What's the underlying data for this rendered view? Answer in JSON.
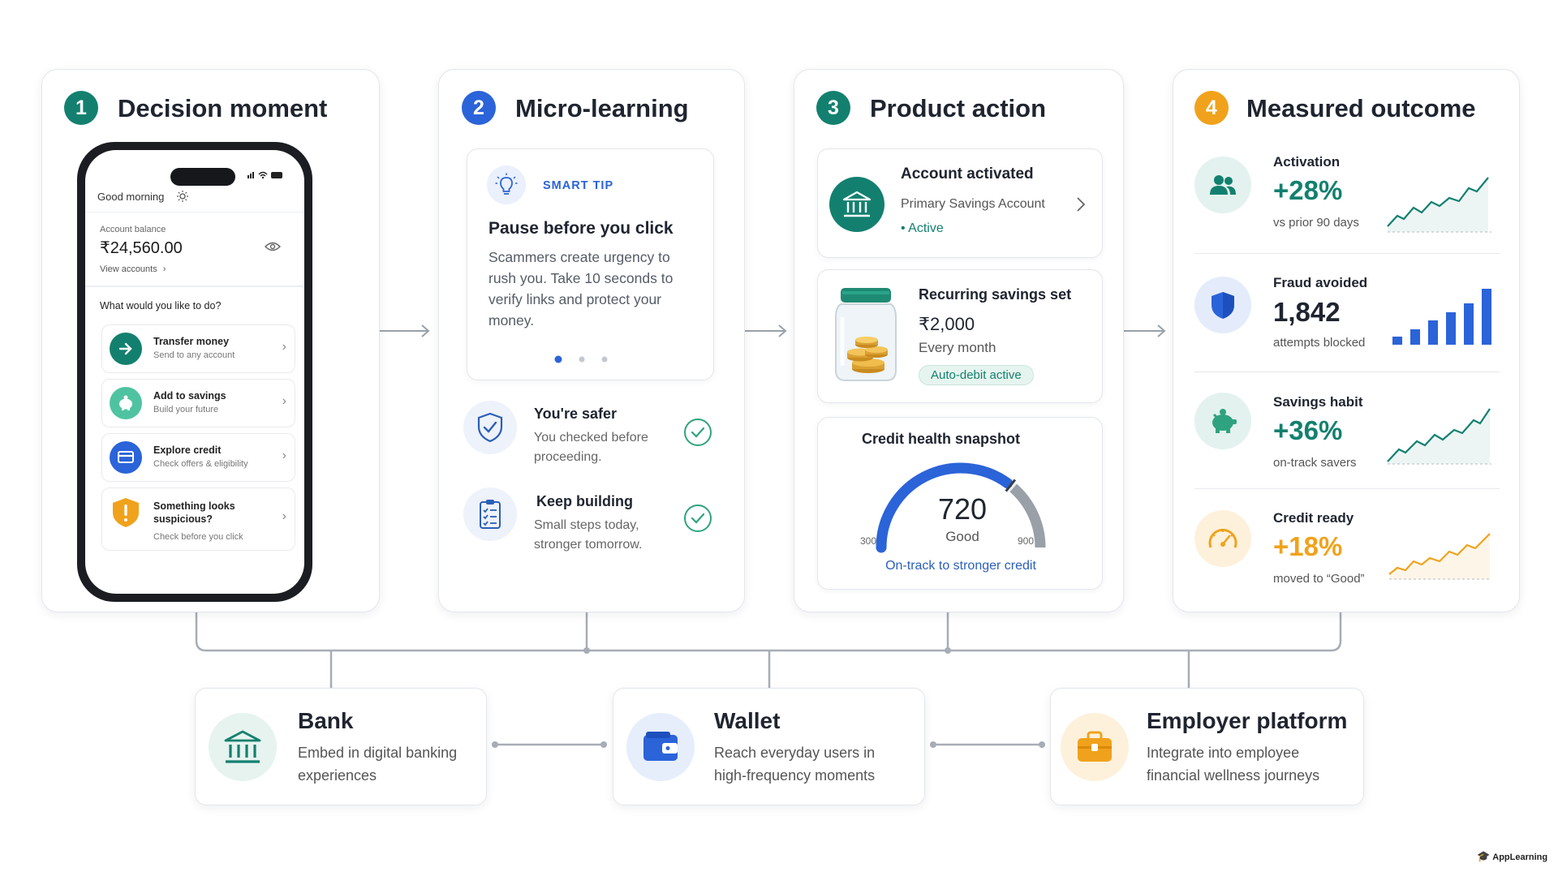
{
  "steps": [
    {
      "num": "1",
      "title": "Decision moment",
      "color": "#13806f"
    },
    {
      "num": "2",
      "title": "Micro-learning",
      "color": "#2b63d9"
    },
    {
      "num": "3",
      "title": "Product action",
      "color": "#13806f"
    },
    {
      "num": "4",
      "title": "Measured outcome",
      "color": "#f0a21c"
    }
  ],
  "phone": {
    "greeting": "Good morning",
    "balance_label": "Account balance",
    "balance": "₹24,560.00",
    "view_accounts": "View accounts",
    "question": "What would you like to do?",
    "actions": [
      {
        "title": "Transfer money",
        "subtitle": "Send to any account",
        "icon": "arrow-right-icon",
        "color": "#13806f"
      },
      {
        "title": "Add to savings",
        "subtitle": "Build your future",
        "icon": "piggy-bank-icon",
        "color": "#4fc3a1"
      },
      {
        "title": "Explore credit",
        "subtitle": "Check offers & eligibility",
        "icon": "credit-card-icon",
        "color": "#2b63d9"
      },
      {
        "title": "Something looks suspicious?",
        "subtitle": "Check before you click",
        "icon": "warning-shield-icon",
        "color": "#f0a21c"
      }
    ]
  },
  "tip": {
    "label": "SMART TIP",
    "title": "Pause before you click",
    "body": "Scammers create urgency to rush you. Take 10 seconds to verify links and protect your money."
  },
  "learning_items": [
    {
      "title": "You're safer",
      "body": "You checked before proceeding.",
      "icon": "shield-check-icon"
    },
    {
      "title": "Keep building",
      "body": "Small steps today, stronger tomorrow.",
      "icon": "clipboard-check-icon"
    }
  ],
  "product": {
    "account": {
      "title": "Account activated",
      "subtitle": "Primary Savings Account",
      "status": "Active"
    },
    "savings": {
      "title": "Recurring savings set",
      "amount": "₹2,000",
      "frequency": "Every month",
      "badge": "Auto-debit active"
    },
    "credit": {
      "title": "Credit health snapshot",
      "score": "720",
      "rating": "Good",
      "min": "300",
      "max": "900",
      "note": "On-track to stronger credit",
      "score_value": 720,
      "score_min": 300,
      "score_max": 900
    }
  },
  "outcomes": [
    {
      "label": "Activation",
      "value": "+28%",
      "sub": "vs prior 90 days",
      "icon": "people-icon",
      "color": "#13806f",
      "bg": "#e3f2ee"
    },
    {
      "label": "Fraud avoided",
      "value": "1,842",
      "sub": "attempts blocked",
      "icon": "shield-icon",
      "color": "#2b63d9",
      "bg": "#e4ecfb"
    },
    {
      "label": "Savings habit",
      "value": "+36%",
      "sub": "on-track savers",
      "icon": "piggy-bank-icon",
      "color": "#13806f",
      "bg": "#e3f2ee"
    },
    {
      "label": "Credit ready",
      "value": "+18%",
      "sub": "moved to “Good”",
      "icon": "gauge-icon",
      "color": "#f0a21c",
      "bg": "#fdf1dc"
    }
  ],
  "channels": [
    {
      "title": "Bank",
      "body": "Embed in digital banking experiences",
      "icon": "bank-icon",
      "color": "#13806f"
    },
    {
      "title": "Wallet",
      "body": "Reach everyday users in high-frequency moments",
      "icon": "wallet-icon",
      "color": "#2b63d9"
    },
    {
      "title": "Employer platform",
      "body": "Integrate into employee financial wellness journeys",
      "icon": "briefcase-icon",
      "color": "#f0a21c"
    }
  ],
  "brand": "AppLearning"
}
